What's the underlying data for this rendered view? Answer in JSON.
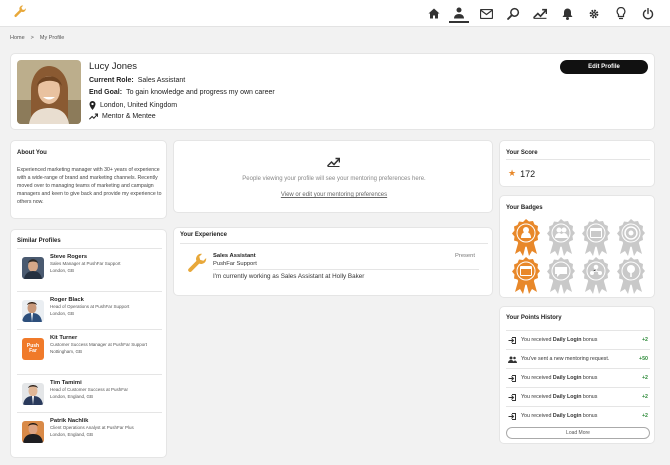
{
  "nav": {
    "items": [
      "home-icon",
      "user-icon",
      "mail-icon",
      "search-icon",
      "trending-icon",
      "bell-icon",
      "gear-icon",
      "lightbulb-icon",
      "power-icon"
    ],
    "active": "user-icon",
    "logo": "wrench-icon"
  },
  "breadcrumb": {
    "home": "Home",
    "separator": ">",
    "current": "My Profile"
  },
  "profile": {
    "name": "Lucy Jones",
    "role_label": "Current Role:",
    "role_value": "Sales Assistant",
    "goal_label": "End Goal:",
    "goal_value": "To gain knowledge and progress my own career",
    "location": "London, United Kingdom",
    "mentor_status": "Mentor & Mentee",
    "edit_button": "Edit Profile"
  },
  "about": {
    "title": "About You",
    "text": "Experienced marketing manager with 30+ years of experience with a wide-range of brand and marketing channels. Recently moved over to managing teams of marketing and campaign managers and keen to give back and provide my experience to others now."
  },
  "similar": {
    "title": "Similar Profiles",
    "people": [
      {
        "name": "Steve Rogers",
        "role": "Sales Manager at PushFar Support",
        "location": "London, GB"
      },
      {
        "name": "Roger Black",
        "role": "Head of Operations at PushFar Support",
        "location": "London, GB"
      },
      {
        "name": "Kit Turner",
        "role": "Customer Success Manager at PushFar Support",
        "location": "Nottingham, GB",
        "logo_text_1": "Push",
        "logo_text_2": "Far"
      },
      {
        "name": "Tim Tamimi",
        "role": "Head of Customer Success at PushFar",
        "location": "London, England, GB"
      },
      {
        "name": "Patrik Nachlik",
        "role": "Client Operations Analyst at PushFar Plus",
        "location": "London, England, GB"
      }
    ]
  },
  "prefs": {
    "text": "People viewing your profile will see your mentoring preferences here.",
    "link": "View or edit your mentoring preferences"
  },
  "experience": {
    "title": "Your Experience",
    "job_title": "Sales Assistant",
    "company": "PushFar Support",
    "period": "Present",
    "description": "I'm currently working as Sales Assistant at Holly Baker"
  },
  "score": {
    "title": "Your Score",
    "value": "172"
  },
  "badges": {
    "title": "Your Badges",
    "items": [
      {
        "icon": "mentee-badge",
        "earned": true
      },
      {
        "icon": "mentor-badge",
        "earned": false
      },
      {
        "icon": "calendar-badge",
        "earned": false
      },
      {
        "icon": "target-badge",
        "earned": false
      },
      {
        "icon": "calendar-badge",
        "earned": true
      },
      {
        "icon": "chat-badge",
        "earned": false
      },
      {
        "icon": "group-badge",
        "earned": false
      },
      {
        "icon": "tree-badge",
        "earned": false
      }
    ]
  },
  "points": {
    "title": "Your Points History",
    "rows": [
      {
        "icon": "login-icon",
        "pre": "You received ",
        "bold": "Daily Login",
        "post": " bonus",
        "value": "+2"
      },
      {
        "icon": "people-icon",
        "pre": "You've sent a new mentoring request.",
        "bold": "",
        "post": "",
        "value": "+50"
      },
      {
        "icon": "login-icon",
        "pre": "You received ",
        "bold": "Daily Login",
        "post": " bonus",
        "value": "+2"
      },
      {
        "icon": "login-icon",
        "pre": "You received ",
        "bold": "Daily Login",
        "post": " bonus",
        "value": "+2"
      },
      {
        "icon": "login-icon",
        "pre": "You received ",
        "bold": "Daily Login",
        "post": " bonus",
        "value": "+2"
      }
    ],
    "load_more": "Load More"
  },
  "colors": {
    "accent": "#e8882a",
    "positive": "#2e8b3a",
    "badge_gray": "#c9c9c9"
  }
}
